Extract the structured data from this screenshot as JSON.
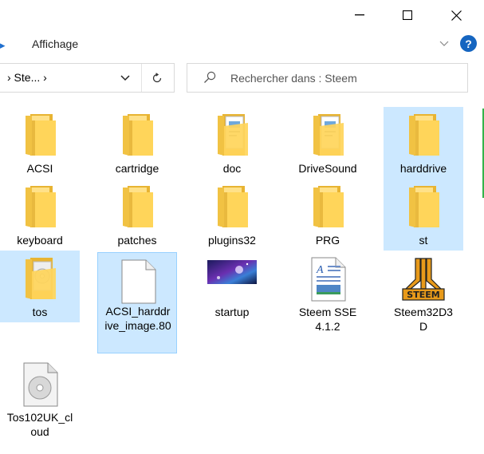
{
  "window": {
    "minimize_glyph": "—",
    "maximize_glyph": "☐",
    "close_glyph": "✕"
  },
  "ribbon": {
    "tab_label": "Affichage",
    "help_glyph": "?"
  },
  "address_bar": {
    "breadcrumb": "› Ste...  ›"
  },
  "search": {
    "placeholder": "Rechercher dans : Steem"
  },
  "files": [
    {
      "name": "ACSI",
      "icon": "folder-icon",
      "selected": false
    },
    {
      "name": "cartridge",
      "icon": "folder-icon",
      "selected": false
    },
    {
      "name": "doc",
      "icon": "folder-with-documents-icon",
      "selected": false
    },
    {
      "name": "DriveSound",
      "icon": "folder-with-documents-icon",
      "selected": false
    },
    {
      "name": "harddrive",
      "icon": "folder-icon",
      "selected": true
    },
    {
      "name": "keyboard",
      "icon": "folder-icon",
      "selected": false
    },
    {
      "name": "patches",
      "icon": "folder-icon",
      "selected": false
    },
    {
      "name": "plugins32",
      "icon": "folder-icon",
      "selected": false
    },
    {
      "name": "PRG",
      "icon": "folder-icon",
      "selected": false
    },
    {
      "name": "st",
      "icon": "folder-icon",
      "selected": true
    },
    {
      "name": "tos",
      "icon": "folder-with-disc-icon",
      "selected": true
    },
    {
      "name": "ACSI_harddrive_image.80",
      "icon": "blank-file-icon",
      "selected": true
    },
    {
      "name": "startup",
      "icon": "image-file-icon",
      "selected": false
    },
    {
      "name": "Steem SSE 4.1.2",
      "icon": "text-document-icon",
      "selected": false
    },
    {
      "name": "Steem32D3D",
      "icon": "atari-steem-icon",
      "selected": false
    },
    {
      "name": "Tos102UK_cloud",
      "icon": "disc-image-icon",
      "selected": false
    }
  ],
  "colors": {
    "selection_bg": "#cce8ff",
    "folder_yellow": "#ffd55a",
    "help_blue": "#1565c0"
  }
}
